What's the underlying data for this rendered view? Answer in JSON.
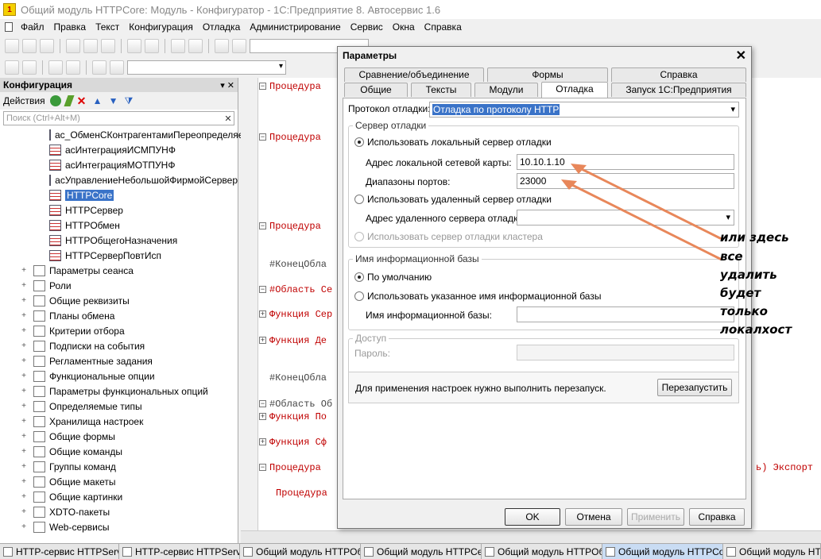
{
  "window": {
    "title": "Общий модуль HTTPCore: Модуль - Конфигуратор - 1С:Предприятие 8. Автосервис 1.6"
  },
  "menu": [
    "Файл",
    "Правка",
    "Текст",
    "Конфигурация",
    "Отладка",
    "Администрирование",
    "Сервис",
    "Окна",
    "Справка"
  ],
  "config_panel": {
    "title": "Конфигурация",
    "actions_label": "Действия",
    "search_placeholder": "Поиск (Ctrl+Alt+M)",
    "modules": [
      "ас_ОбменСКонтрагентамиПереопределяемый",
      "асИнтеграцияИСМПУНФ",
      "асИнтеграцияМОТПУНФ",
      "асУправлениеНебольшойФирмойСервер",
      "HTTPCore",
      "HTTPСервер",
      "HTTPОбмен",
      "HTTPОбщегоНазначения",
      "HTTPСерверПовтИсп"
    ],
    "selected_module": "HTTPCore",
    "groups": [
      "Параметры сеанса",
      "Роли",
      "Общие реквизиты",
      "Планы обмена",
      "Критерии отбора",
      "Подписки на события",
      "Регламентные задания",
      "Функциональные опции",
      "Параметры функциональных опций",
      "Определяемые типы",
      "Хранилища настроек",
      "Общие формы",
      "Общие команды",
      "Группы команд",
      "Общие макеты",
      "Общие картинки",
      "XDTO-пакеты",
      "Web-сервисы"
    ]
  },
  "code": [
    {
      "text": "Процедура",
      "dark": false
    },
    {
      "text": "Процедура",
      "dark": false
    },
    {
      "text": "Процедура",
      "dark": false
    },
    {
      "text": "#КонецОбла",
      "dark": true
    },
    {
      "text": "#Область Се",
      "dark": false
    },
    {
      "text": "Функция Сер",
      "dark": false
    },
    {
      "text": "Функция Де",
      "dark": false
    },
    {
      "text": "#КонецОбла",
      "dark": true
    },
    {
      "text": "#Область Об",
      "dark": true
    },
    {
      "text": "Функция По",
      "dark": false
    },
    {
      "text": "Функция Сф",
      "dark": false
    },
    {
      "text": "Процедура",
      "dark": false
    },
    {
      "text": "Процедура",
      "dark": false
    }
  ],
  "code_tail": "ь) Экспорт",
  "dialog": {
    "title": "Параметры",
    "tabs_row1": [
      "Сравнение/объединение",
      "Формы",
      "Справка"
    ],
    "tabs_row2": [
      "Общие",
      "Тексты",
      "Модули",
      "Отладка",
      "Запуск 1С:Предприятия"
    ],
    "active_tab": "Отладка",
    "protocol_label": "Протокол отладки:",
    "protocol_value": "Отладка по протоколу HTTP",
    "server_group": "Сервер отладки",
    "use_local": "Использовать локальный сервер отладки",
    "local_addr_label": "Адрес локальной сетевой карты:",
    "local_addr_value": "10.10.1.10",
    "ports_label": "Диапазоны портов:",
    "ports_value": "23000",
    "use_remote": "Использовать удаленный сервер отладки",
    "remote_addr_label": "Адрес удаленного сервера отладки:",
    "use_cluster": "Использовать сервер отладки кластера",
    "ib_group": "Имя информационной базы",
    "default_radio": "По умолчанию",
    "use_named": "Использовать указанное имя информационной базы",
    "ib_name_label": "Имя информационной базы:",
    "access_group": "Доступ",
    "password_label": "Пароль:",
    "restart_notice": "Для применения настроек нужно выполнить перезапуск.",
    "restart_button": "Перезапустить",
    "ok": "OK",
    "cancel": "Отмена",
    "apply": "Применить",
    "help": "Справка"
  },
  "annotation": [
    "или здесь",
    "все",
    "удалить",
    "будет",
    "только",
    "локалхост"
  ],
  "annotation_color": "#e8875a",
  "taskbar": [
    "HTTP-сервис HTTPServ...",
    "HTTP-сервис HTTPServ...",
    "Общий модуль HTTPОб...",
    "Общий модуль HTTPСе...",
    "Общий модуль HTTPОб...",
    "Общий модуль HTTPCo...",
    "Общий модуль HTTPO..."
  ]
}
